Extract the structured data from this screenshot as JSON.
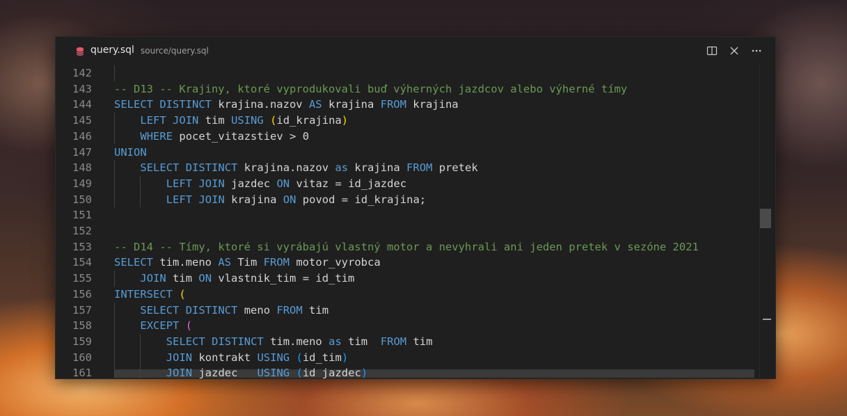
{
  "tab": {
    "icon": "database-icon",
    "file_name": "query.sql",
    "file_path": "source/query.sql"
  },
  "actions": {
    "split": "split-editor-icon",
    "close": "close-icon",
    "more": "more-actions-icon"
  },
  "colors": {
    "keyword": "#569cd6",
    "comment": "#6a9955",
    "text": "#d4d4d4",
    "bracket_gold": "#ffd700",
    "bracket_orchid": "#da70d6",
    "bracket_blue": "#179fff",
    "db_icon": "#e05a6e"
  },
  "editor": {
    "line_numbers": [
      "142",
      "143",
      "144",
      "145",
      "146",
      "147",
      "148",
      "149",
      "150",
      "151",
      "152",
      "153",
      "154",
      "155",
      "156",
      "157",
      "158",
      "159",
      "160",
      "161"
    ],
    "lines": [
      {
        "indent": 0,
        "tokens": []
      },
      {
        "indent": 0,
        "tokens": [
          {
            "t": "cm",
            "v": "-- D13 -- Krajiny, ktoré vyprodukovali buď výherných jazdcov alebo výherné tímy"
          }
        ]
      },
      {
        "indent": 0,
        "tokens": [
          {
            "t": "kw",
            "v": "SELECT DISTINCT"
          },
          {
            "t": "tx",
            "v": " krajina.nazov "
          },
          {
            "t": "kw",
            "v": "AS"
          },
          {
            "t": "tx",
            "v": " krajina "
          },
          {
            "t": "kw",
            "v": "FROM"
          },
          {
            "t": "tx",
            "v": " krajina"
          }
        ]
      },
      {
        "indent": 1,
        "tokens": [
          {
            "t": "kw",
            "v": "LEFT JOIN"
          },
          {
            "t": "tx",
            "v": " tim "
          },
          {
            "t": "kw",
            "v": "USING"
          },
          {
            "t": "tx",
            "v": " "
          },
          {
            "t": "p1",
            "v": "("
          },
          {
            "t": "tx",
            "v": "id_krajina"
          },
          {
            "t": "p1",
            "v": ")"
          }
        ]
      },
      {
        "indent": 1,
        "tokens": [
          {
            "t": "kw",
            "v": "WHERE"
          },
          {
            "t": "tx",
            "v": " pocet_vitazstiev > 0"
          }
        ]
      },
      {
        "indent": 0,
        "tokens": [
          {
            "t": "kw",
            "v": "UNION"
          }
        ]
      },
      {
        "indent": 1,
        "tokens": [
          {
            "t": "kw",
            "v": "SELECT DISTINCT"
          },
          {
            "t": "tx",
            "v": " krajina.nazov "
          },
          {
            "t": "kw",
            "v": "as"
          },
          {
            "t": "tx",
            "v": " krajina "
          },
          {
            "t": "kw",
            "v": "FROM"
          },
          {
            "t": "tx",
            "v": " pretek"
          }
        ]
      },
      {
        "indent": 2,
        "tokens": [
          {
            "t": "kw",
            "v": "LEFT JOIN"
          },
          {
            "t": "tx",
            "v": " jazdec "
          },
          {
            "t": "kw",
            "v": "ON"
          },
          {
            "t": "tx",
            "v": " vitaz = id_jazdec"
          }
        ]
      },
      {
        "indent": 2,
        "tokens": [
          {
            "t": "kw",
            "v": "LEFT JOIN"
          },
          {
            "t": "tx",
            "v": " krajina "
          },
          {
            "t": "kw",
            "v": "ON"
          },
          {
            "t": "tx",
            "v": " povod = id_krajina;"
          }
        ]
      },
      {
        "indent": 0,
        "tokens": []
      },
      {
        "indent": 0,
        "tokens": []
      },
      {
        "indent": 0,
        "tokens": [
          {
            "t": "cm",
            "v": "-- D14 -- Tímy, ktoré si vyrábajú vlastný motor a nevyhrali ani jeden pretek v sezóne 2021"
          }
        ]
      },
      {
        "indent": 0,
        "tokens": [
          {
            "t": "kw",
            "v": "SELECT"
          },
          {
            "t": "tx",
            "v": " tim.meno "
          },
          {
            "t": "kw",
            "v": "AS"
          },
          {
            "t": "tx",
            "v": " Tim "
          },
          {
            "t": "kw",
            "v": "FROM"
          },
          {
            "t": "tx",
            "v": " motor_vyrobca"
          }
        ]
      },
      {
        "indent": 1,
        "tokens": [
          {
            "t": "kw",
            "v": "JOIN"
          },
          {
            "t": "tx",
            "v": " tim "
          },
          {
            "t": "kw",
            "v": "ON"
          },
          {
            "t": "tx",
            "v": " vlastnik_tim = id_tim"
          }
        ]
      },
      {
        "indent": 0,
        "tokens": [
          {
            "t": "kw",
            "v": "INTERSECT"
          },
          {
            "t": "tx",
            "v": " "
          },
          {
            "t": "p1",
            "v": "("
          }
        ]
      },
      {
        "indent": 1,
        "tokens": [
          {
            "t": "kw",
            "v": "SELECT DISTINCT"
          },
          {
            "t": "tx",
            "v": " meno "
          },
          {
            "t": "kw",
            "v": "FROM"
          },
          {
            "t": "tx",
            "v": " tim"
          }
        ]
      },
      {
        "indent": 1,
        "tokens": [
          {
            "t": "kw",
            "v": "EXCEPT"
          },
          {
            "t": "tx",
            "v": " "
          },
          {
            "t": "p2",
            "v": "("
          }
        ]
      },
      {
        "indent": 2,
        "tokens": [
          {
            "t": "kw",
            "v": "SELECT DISTINCT"
          },
          {
            "t": "tx",
            "v": " tim.meno "
          },
          {
            "t": "kw",
            "v": "as"
          },
          {
            "t": "tx",
            "v": " tim  "
          },
          {
            "t": "kw",
            "v": "FROM"
          },
          {
            "t": "tx",
            "v": " tim"
          }
        ]
      },
      {
        "indent": 2,
        "tokens": [
          {
            "t": "kw",
            "v": "JOIN"
          },
          {
            "t": "tx",
            "v": " kontrakt "
          },
          {
            "t": "kw",
            "v": "USING"
          },
          {
            "t": "tx",
            "v": " "
          },
          {
            "t": "p3",
            "v": "("
          },
          {
            "t": "tx",
            "v": "id_tim"
          },
          {
            "t": "p3",
            "v": ")"
          }
        ]
      },
      {
        "indent": 2,
        "tokens": [
          {
            "t": "kw",
            "v": "JOIN"
          },
          {
            "t": "tx",
            "v": " jazdec   "
          },
          {
            "t": "kw",
            "v": "USING"
          },
          {
            "t": "tx",
            "v": " "
          },
          {
            "t": "p3",
            "v": "("
          },
          {
            "t": "tx",
            "v": "id_jazdec"
          },
          {
            "t": "p3",
            "v": ")"
          }
        ]
      }
    ]
  }
}
